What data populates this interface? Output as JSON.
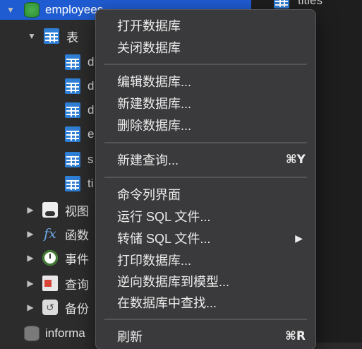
{
  "sidebar": {
    "db_name": "employees",
    "tables_group": "表",
    "table_items": [
      "d",
      "d",
      "d",
      "e",
      "s",
      "ti"
    ],
    "groups": [
      {
        "label": "视图",
        "icon": "view-icon"
      },
      {
        "label": "函数",
        "icon": "function-icon"
      },
      {
        "label": "事件",
        "icon": "event-icon"
      },
      {
        "label": "查询",
        "icon": "query-icon"
      },
      {
        "label": "备份",
        "icon": "backup-icon"
      }
    ],
    "next_db": "informa"
  },
  "right_pane": {
    "visible_table": "titles"
  },
  "context_menu": {
    "items": [
      {
        "label": "打开数据库"
      },
      {
        "label": "关闭数据库"
      },
      {
        "label": "编辑数据库..."
      },
      {
        "label": "新建数据库..."
      },
      {
        "label": "删除数据库..."
      },
      {
        "label": "新建查询...",
        "shortcut": "⌘Y"
      },
      {
        "label": "命令列界面"
      },
      {
        "label": "运行 SQL 文件..."
      },
      {
        "label": "转储 SQL 文件...",
        "submenu": "▶"
      },
      {
        "label": "打印数据库..."
      },
      {
        "label": "逆向数据库到模型..."
      },
      {
        "label": "在数据库中查找..."
      },
      {
        "label": "刷新",
        "shortcut": "⌘R"
      }
    ]
  },
  "colors": {
    "selection": "#1f5bd1",
    "menu_bg": "#3a3a3c",
    "db_icon_green": "#48b04e",
    "table_icon_blue": "#2f7fd6"
  }
}
